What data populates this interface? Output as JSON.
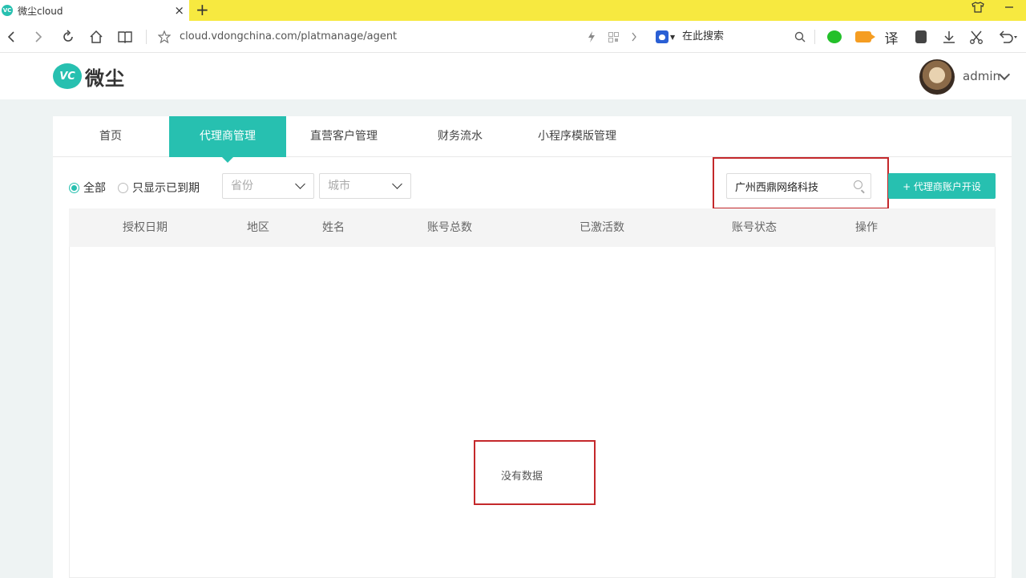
{
  "browser": {
    "tab_title": "微尘cloud",
    "favicon_text": "VC",
    "tab_close": "×",
    "new_tab": "+",
    "url": "cloud.vdongchina.com/platmanage/agent",
    "search_engine_text": "在此搜索",
    "translate_label": "译",
    "icons": [
      "back-icon",
      "forward-icon",
      "reload-icon",
      "home-icon",
      "reader-icon",
      "star-icon",
      "lightning-icon",
      "qr-icon",
      "chevron-right-icon",
      "search-icon",
      "wechat-icon",
      "video-icon",
      "translate-icon",
      "evernote-icon",
      "download-icon",
      "scissors-icon",
      "undo-icon",
      "shirt-icon",
      "minimize-icon"
    ]
  },
  "header": {
    "logo_mark": "VC",
    "logo_text": "微尘",
    "user_name": "admin"
  },
  "nav": {
    "items": [
      {
        "label": "首页"
      },
      {
        "label": "代理商管理"
      },
      {
        "label": "直营客户管理"
      },
      {
        "label": "财务流水"
      },
      {
        "label": "小程序模版管理"
      }
    ],
    "active_index": 1
  },
  "filters": {
    "radio_all": "全部",
    "radio_expired": "只显示已到期",
    "province_placeholder": "省份",
    "city_placeholder": "城市",
    "search_value": "广州西鼎网络科技",
    "add_button": "+ 代理商账户开设"
  },
  "table": {
    "columns": [
      "授权日期",
      "地区",
      "姓名",
      "账号总数",
      "已激活数",
      "账号状态",
      "操作"
    ],
    "empty_text": "没有数据"
  },
  "colors": {
    "accent": "#27c0b0",
    "tabbar": "#f7e940",
    "highlight": "#c4282b"
  }
}
